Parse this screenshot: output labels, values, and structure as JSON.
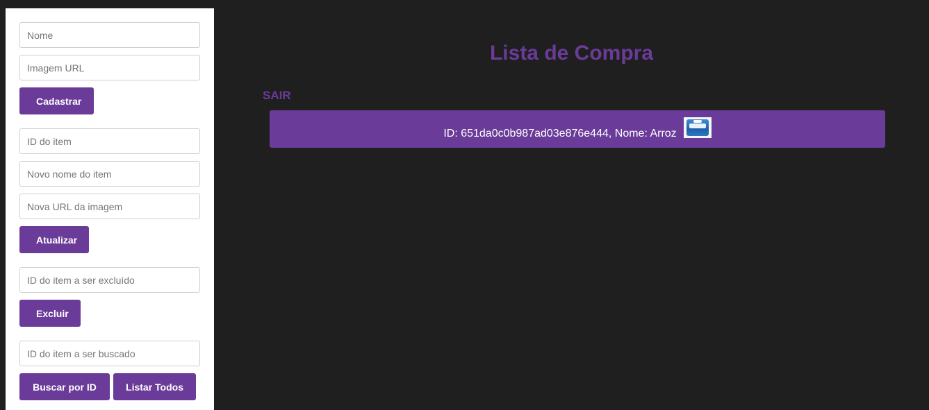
{
  "sidebar": {
    "create": {
      "name_placeholder": "Nome",
      "image_placeholder": "Imagem URL",
      "submit_label": "Cadastrar"
    },
    "update": {
      "id_placeholder": "ID do item",
      "name_placeholder": "Novo nome do item",
      "image_placeholder": "Nova URL da imagem",
      "submit_label": "Atualizar"
    },
    "delete": {
      "id_placeholder": "ID do item a ser excluído",
      "submit_label": "Excluir"
    },
    "search": {
      "id_placeholder": "ID do item a ser buscado",
      "search_label": "Buscar por ID",
      "list_all_label": "Listar Todos"
    }
  },
  "main": {
    "title": "Lista de Compra",
    "logout_label": "SAIR",
    "items": [
      {
        "text": "ID: 651da0c0b987ad03e876e444, Nome: Arroz",
        "image_icon": "rice-package-thumbnail"
      }
    ]
  },
  "colors": {
    "accent": "#6a3b99",
    "background": "#1f1f1f",
    "sidebar_bg": "#ffffff"
  }
}
